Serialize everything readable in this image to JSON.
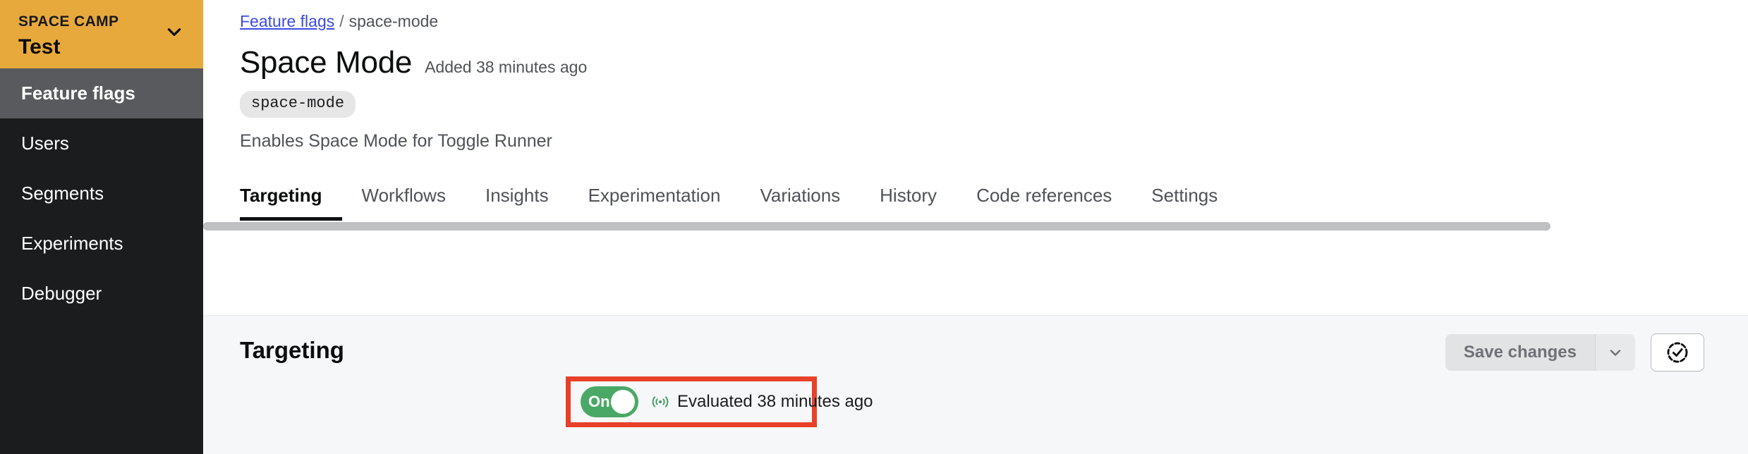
{
  "sidebar": {
    "org": {
      "label": "SPACE CAMP",
      "name": "Test",
      "chevron_icon": "chevron-down-icon"
    },
    "items": [
      {
        "label": "Feature flags",
        "active": true
      },
      {
        "label": "Users",
        "active": false
      },
      {
        "label": "Segments",
        "active": false
      },
      {
        "label": "Experiments",
        "active": false
      },
      {
        "label": "Debugger",
        "active": false
      }
    ],
    "colors": {
      "org_background": "#e8a93c",
      "background": "#1b1c1d",
      "active_background": "#585a5d",
      "text": "#ffffff"
    }
  },
  "breadcrumb": {
    "link": "Feature flags",
    "separator": "/",
    "current": "space-mode",
    "link_color": "#3b4be8"
  },
  "flag": {
    "title": "Space Mode",
    "added": "Added 38 minutes ago",
    "key_tag": "space-mode",
    "description": "Enables Space Mode for Toggle Runner"
  },
  "tabs": [
    {
      "label": "Targeting",
      "active": true
    },
    {
      "label": "Workflows",
      "active": false
    },
    {
      "label": "Insights",
      "active": false
    },
    {
      "label": "Experimentation",
      "active": false
    },
    {
      "label": "Variations",
      "active": false
    },
    {
      "label": "History",
      "active": false
    },
    {
      "label": "Code references",
      "active": false
    },
    {
      "label": "Settings",
      "active": false
    }
  ],
  "targeting": {
    "heading": "Targeting",
    "toggle": {
      "state_label": "On",
      "on": true,
      "color": "#4aa866"
    },
    "evaluated_text": "Evaluated 38 minutes ago",
    "evaluated_icon": "broadcast-signal-icon",
    "highlight_color": "#e8412a"
  },
  "actions": {
    "save_label": "Save changes",
    "save_caret_icon": "chevron-down-icon",
    "review_icon": "approval-check-circle-icon"
  },
  "scrollbar": {
    "orientation": "horizontal",
    "thumb_color": "#bfc0c2"
  }
}
